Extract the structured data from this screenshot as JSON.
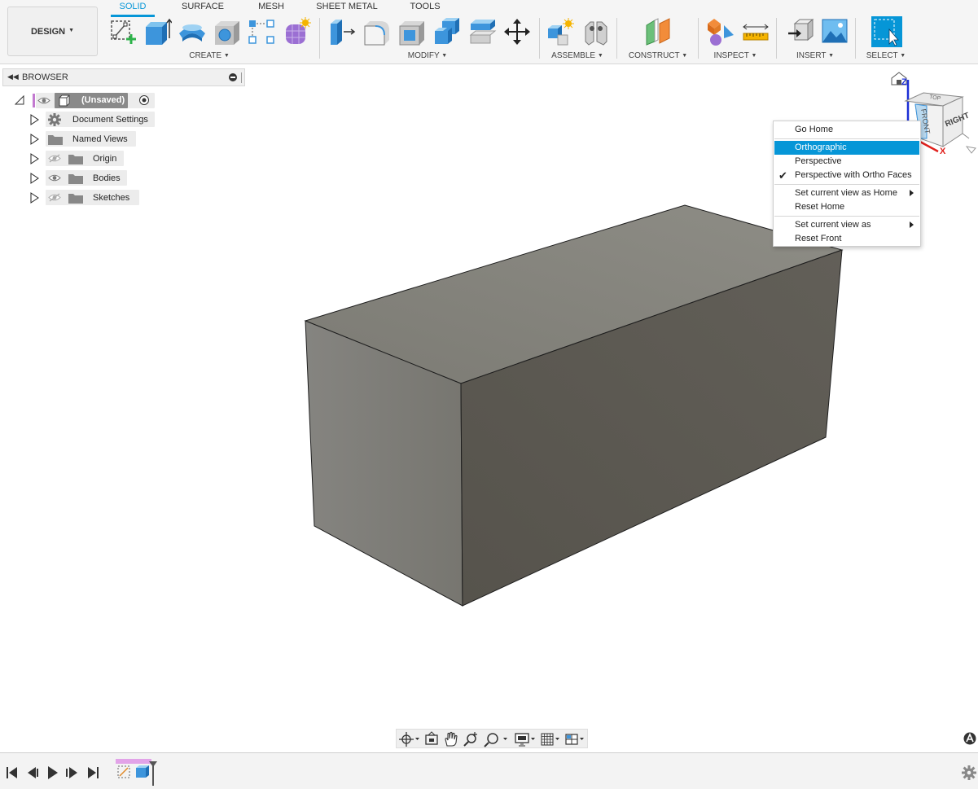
{
  "toolbar": {
    "design_button": "DESIGN",
    "tabs": [
      {
        "label": "SOLID",
        "active": true
      },
      {
        "label": "SURFACE",
        "active": false
      },
      {
        "label": "MESH",
        "active": false
      },
      {
        "label": "SHEET METAL",
        "active": false
      },
      {
        "label": "TOOLS",
        "active": false
      }
    ],
    "groups": {
      "create": "CREATE",
      "modify": "MODIFY",
      "assemble": "ASSEMBLE",
      "construct": "CONSTRUCT",
      "inspect": "INSPECT",
      "insert": "INSERT",
      "select": "SELECT"
    },
    "accent_color": "#0696d7"
  },
  "browser": {
    "title": "BROWSER",
    "root": "(Unsaved)",
    "items": [
      {
        "label": "Document Settings",
        "icon": "gear-icon"
      },
      {
        "label": "Named Views",
        "icon": "folder-icon"
      },
      {
        "label": "Origin",
        "icon": "folder-icon",
        "visibility": "hidden"
      },
      {
        "label": "Bodies",
        "icon": "folder-icon",
        "visibility": "visible"
      },
      {
        "label": "Sketches",
        "icon": "folder-icon",
        "visibility": "hidden"
      }
    ]
  },
  "viewcube": {
    "axis_z": "Z",
    "axis_x": "X",
    "face_right": "RIGHT",
    "face_front": "FRONT",
    "face_top": "TOP"
  },
  "view_menu": {
    "go_home": "Go Home",
    "orthographic": "Orthographic",
    "perspective": "Perspective",
    "perspective_ortho": "Perspective with Ortho Faces",
    "set_home": "Set current view as Home",
    "reset_home": "Reset Home",
    "set_view_as": "Set current view as",
    "reset_front": "Reset Front",
    "highlighted": "Orthographic",
    "checked": "Perspective with Ortho Faces"
  },
  "model": {
    "face_colors": {
      "top": "#8a8982",
      "left": "#7e7d76",
      "right": "#5e5c55"
    }
  }
}
